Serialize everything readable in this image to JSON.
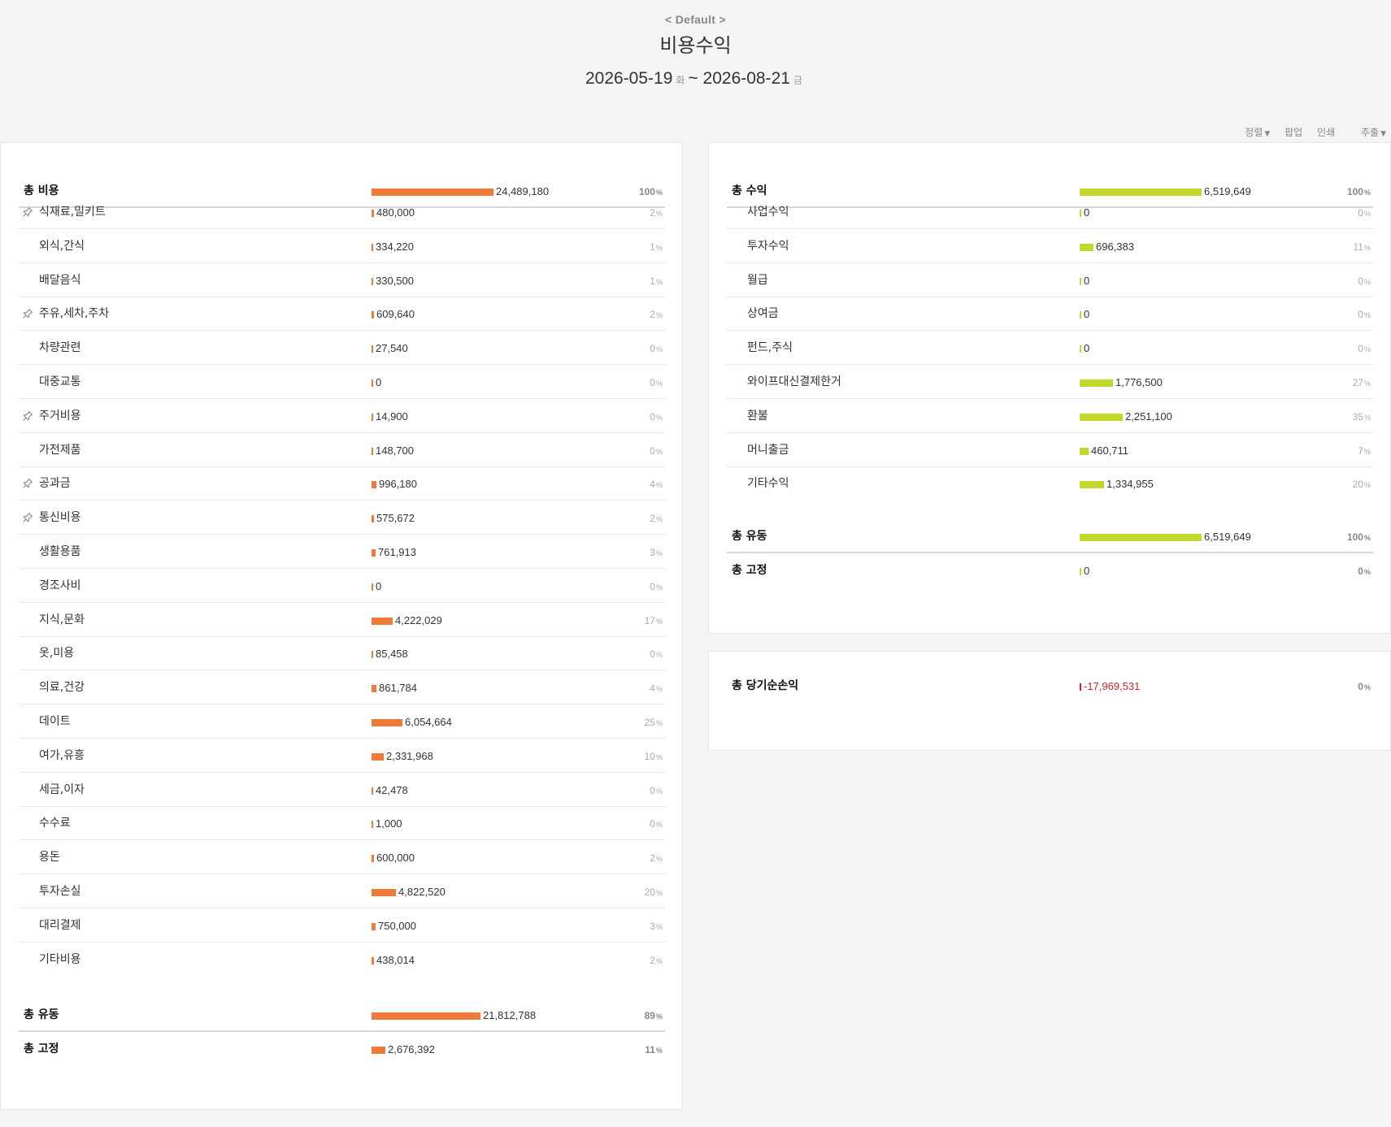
{
  "header": {
    "preset": "< Default >",
    "title": "비용수익",
    "start_date": "2026-05-19",
    "start_dow": "화",
    "separator": "~",
    "end_date": "2026-08-21",
    "end_dow": "금"
  },
  "toolbar": {
    "sort": "정렬",
    "popup": "팝업",
    "print": "인쇄",
    "export": "추출"
  },
  "colors": {
    "expense": "#f07a3a",
    "income": "#c2d82a",
    "negative": "#c62828"
  },
  "pct_unit": "%",
  "expense": {
    "total": {
      "label": "총 비용",
      "value": "24,489,180",
      "pct": "100"
    },
    "items": [
      {
        "label": "식재료,밀키트",
        "value": "480,000",
        "pct": "2",
        "pinned": true
      },
      {
        "label": "외식,간식",
        "value": "334,220",
        "pct": "1",
        "pinned": false
      },
      {
        "label": "배달음식",
        "value": "330,500",
        "pct": "1",
        "pinned": false
      },
      {
        "label": "주유,세차,주차",
        "value": "609,640",
        "pct": "2",
        "pinned": true
      },
      {
        "label": "차량관련",
        "value": "27,540",
        "pct": "0",
        "pinned": false
      },
      {
        "label": "대중교통",
        "value": "0",
        "pct": "0",
        "pinned": false
      },
      {
        "label": "주거비용",
        "value": "14,900",
        "pct": "0",
        "pinned": true
      },
      {
        "label": "가전제품",
        "value": "148,700",
        "pct": "0",
        "pinned": false
      },
      {
        "label": "공과금",
        "value": "996,180",
        "pct": "4",
        "pinned": true
      },
      {
        "label": "통신비용",
        "value": "575,672",
        "pct": "2",
        "pinned": true
      },
      {
        "label": "생활용품",
        "value": "761,913",
        "pct": "3",
        "pinned": false
      },
      {
        "label": "경조사비",
        "value": "0",
        "pct": "0",
        "pinned": false
      },
      {
        "label": "지식,문화",
        "value": "4,222,029",
        "pct": "17",
        "pinned": false
      },
      {
        "label": "옷,미용",
        "value": "85,458",
        "pct": "0",
        "pinned": false
      },
      {
        "label": "의료,건강",
        "value": "861,784",
        "pct": "4",
        "pinned": false
      },
      {
        "label": "데이트",
        "value": "6,054,664",
        "pct": "25",
        "pinned": false
      },
      {
        "label": "여가,유흥",
        "value": "2,331,968",
        "pct": "10",
        "pinned": false
      },
      {
        "label": "세금,이자",
        "value": "42,478",
        "pct": "0",
        "pinned": false
      },
      {
        "label": "수수료",
        "value": "1,000",
        "pct": "0",
        "pinned": false
      },
      {
        "label": "용돈",
        "value": "600,000",
        "pct": "2",
        "pinned": false
      },
      {
        "label": "투자손실",
        "value": "4,822,520",
        "pct": "20",
        "pinned": false
      },
      {
        "label": "대리결제",
        "value": "750,000",
        "pct": "3",
        "pinned": false
      },
      {
        "label": "기타비용",
        "value": "438,014",
        "pct": "2",
        "pinned": false
      }
    ],
    "variable": {
      "label": "총 유동",
      "value": "21,812,788",
      "pct": "89"
    },
    "fixed": {
      "label": "총 고정",
      "value": "2,676,392",
      "pct": "11"
    }
  },
  "income": {
    "total": {
      "label": "총 수익",
      "value": "6,519,649",
      "pct": "100"
    },
    "items": [
      {
        "label": "사업수익",
        "value": "0",
        "pct": "0"
      },
      {
        "label": "투자수익",
        "value": "696,383",
        "pct": "11"
      },
      {
        "label": "월급",
        "value": "0",
        "pct": "0"
      },
      {
        "label": "상여금",
        "value": "0",
        "pct": "0"
      },
      {
        "label": "펀드,주식",
        "value": "0",
        "pct": "0"
      },
      {
        "label": "와이프대신결제한거",
        "value": "1,776,500",
        "pct": "27"
      },
      {
        "label": "환불",
        "value": "2,251,100",
        "pct": "35"
      },
      {
        "label": "머니출금",
        "value": "460,711",
        "pct": "7"
      },
      {
        "label": "기타수익",
        "value": "1,334,955",
        "pct": "20"
      }
    ],
    "variable": {
      "label": "총 유동",
      "value": "6,519,649",
      "pct": "100"
    },
    "fixed": {
      "label": "총 고정",
      "value": "0",
      "pct": "0"
    }
  },
  "net": {
    "label": "총 당기순손익",
    "value": "-17,969,531",
    "pct": "0"
  }
}
